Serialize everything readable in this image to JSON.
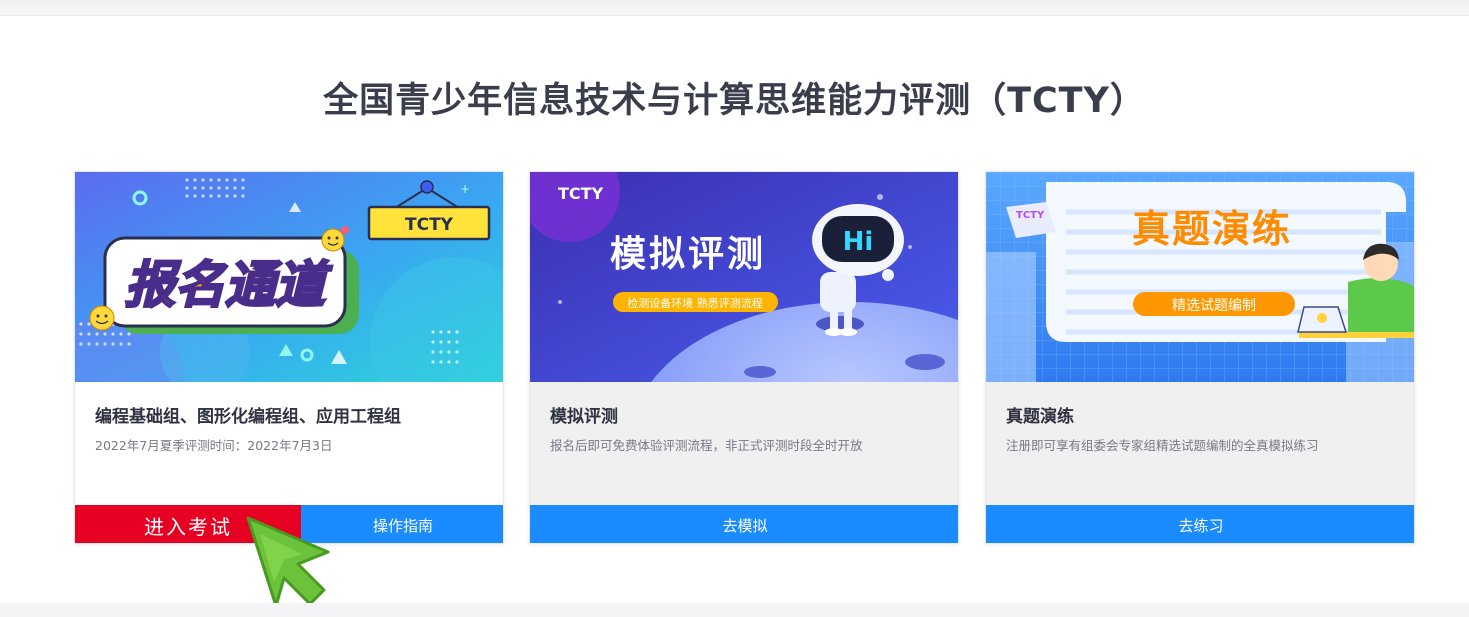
{
  "page": {
    "title": "全国青少年信息技术与计算思维能力评测（TCTY）"
  },
  "cards": [
    {
      "banner": {
        "main_text": "报名通道",
        "tag": "TCTY"
      },
      "title": "编程基础组、图形化编程组、应用工程组",
      "subtitle": "2022年7月夏季评测时间：2022年7月3日",
      "buttons": [
        {
          "label": "进入考试",
          "color": "#e60021"
        },
        {
          "label": "操作指南",
          "color": "#1a8cff"
        }
      ]
    },
    {
      "banner": {
        "logo": "TCTY",
        "main_text": "模拟评测",
        "pill": "检测设备环境 熟悉评测流程",
        "robot_text": "Hi"
      },
      "title": "模拟评测",
      "subtitle": "报名后即可免费体验评测流程，非正式评测时段全时开放",
      "buttons": [
        {
          "label": "去模拟",
          "color": "#1a8cff"
        }
      ]
    },
    {
      "banner": {
        "main_text": "真题演练",
        "pill": "精选试题编制",
        "tag": "TCTY"
      },
      "title": "真题演练",
      "subtitle": "注册即可享有组委会专家组精选试题编制的全真模拟练习",
      "buttons": [
        {
          "label": "去练习",
          "color": "#1a8cff"
        }
      ]
    }
  ],
  "overlay": {
    "cursor_icon": "arrow-cursor-icon",
    "cursor_color": "#6cc23a"
  }
}
